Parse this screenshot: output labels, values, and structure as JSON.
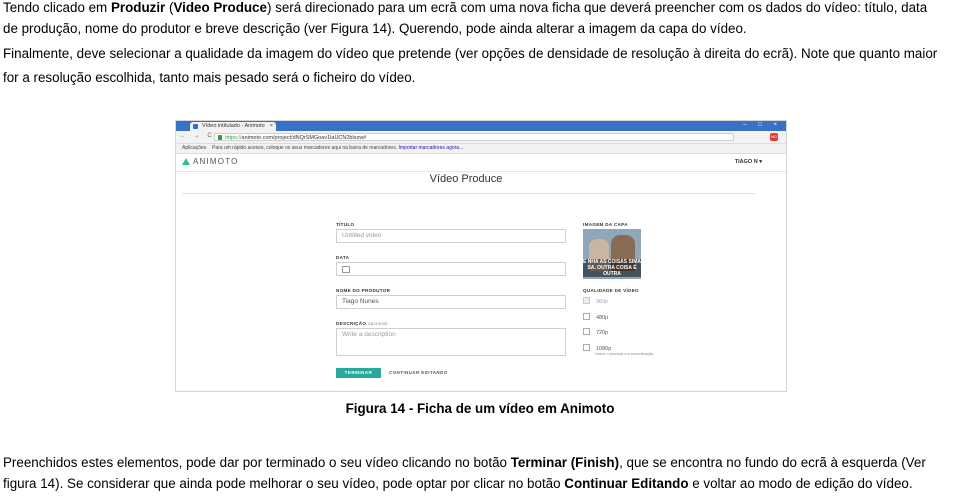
{
  "paragraphs": {
    "p1": {
      "line1": {
        "a": "Tendo clicado em ",
        "b": "Produzir",
        "c": " (",
        "d": "Video Produce",
        "e": ") será direcionado para um ecrã com uma nova ficha que deverá preencher com os dados do vídeo: título, data"
      },
      "line2": "de produção, nome do produtor e breve descrição (ver Figura 14). Querendo, pode ainda alterar a imagem da capa do vídeo."
    },
    "p2": {
      "line1": "Finalmente, deve selecionar a qualidade da imagem do vídeo que pretende (ver opções de densidade de resolução à direita do ecrã). Note que quanto maior",
      "line2": "for a resolução escolhida, tanto mais pesado será o ficheiro do vídeo."
    },
    "caption": "Figura 14 - Ficha de um vídeo em Animoto",
    "p3": {
      "line1": {
        "a": "Preenchidos estes elementos, pode dar por terminado o seu vídeo clicando no botão ",
        "b": "Terminar (Finish)",
        "c": ", que se encontra no fundo do ecrã à esquerda (Ver"
      },
      "line2": {
        "a": "figura 14). Se considerar que ainda pode melhorar o seu vídeo, pode optar por clicar no botão ",
        "b": "Continuar Editando",
        "c": " e voltar ao modo de edição do vídeo."
      }
    }
  },
  "screenshot": {
    "browser": {
      "tab_title": "Vídeo intitulado - Animoto",
      "tab_close": "×",
      "window_controls": "– □ ×",
      "nav_buttons": "← → C",
      "url_secure": "https://",
      "url_rest": "animoto.com/project/dNQrSMGoav1laUCN2blxzw#",
      "extension_badge": "NG",
      "apps_label": "Aplicações",
      "bookmarks_text": "Para um rápido acesso, coloque os seus marcadores aqui na barra de marcadores.",
      "import_link": "Importar marcadores agora..."
    },
    "app": {
      "logo_text": "ANIMOTO",
      "user_label": "TIAGO N ▾",
      "page_title": "Vídeo Produce",
      "form": {
        "title_label": "TÍTULO",
        "title_placeholder": "Untitled video",
        "date_label": "DATA",
        "producer_label": "NOME DO PRODUTOR",
        "producer_value": "Tiago Nunes",
        "description_label": "DESCRIÇÃO",
        "description_optional": "opcional",
        "description_placeholder": "Write a description",
        "cover_label": "IMAGEM DA CAPA",
        "cover_text": "E NHA AS COISAS SIMA SA. OUTRA COISA É OUTRA",
        "quality_label": "QUALIDADE DE VÍDEO",
        "quality_options": [
          "360p",
          "480p",
          "720p",
          "1080p"
        ],
        "quality_note": "Único o produto em escorticação",
        "finish_button": "TERMINAR",
        "continue_button": "CONTINUAR EDITANDO"
      }
    }
  }
}
